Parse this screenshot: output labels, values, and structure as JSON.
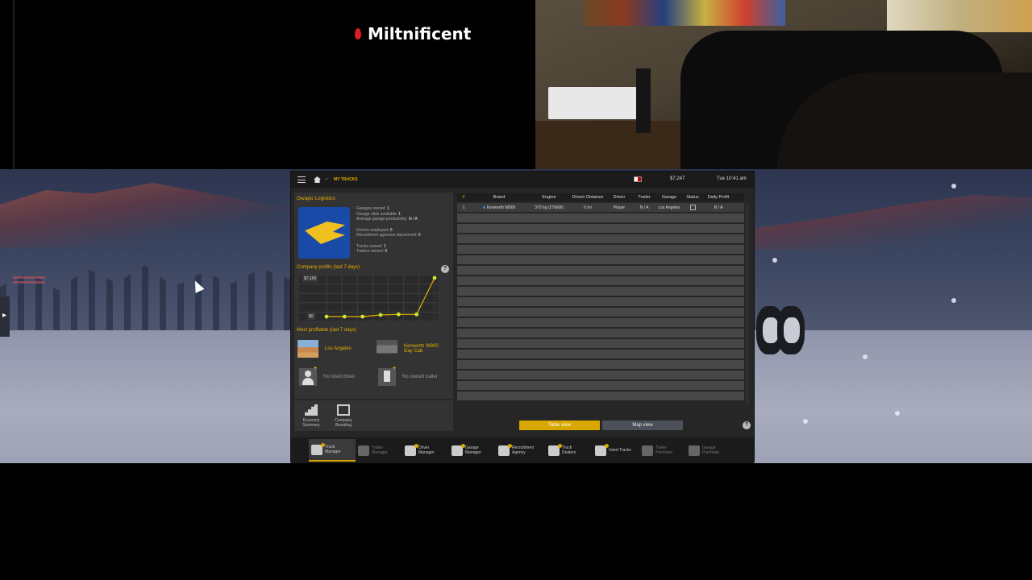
{
  "stream": {
    "name": "Miltnificent"
  },
  "topbar": {
    "breadcrumb": "MY TRUCKS",
    "money": "$7,247",
    "clock": "Tue 10:41 am"
  },
  "company": {
    "name": "Gwapo Logistics",
    "stats": {
      "garages_owned": "Garages owned: ",
      "garages_owned_v": "1",
      "garage_slots": "Garage slots available: ",
      "garage_slots_v": "1",
      "productivity": "Average garage productivity: ",
      "productivity_v": "N / A",
      "drivers": "Drivers employed: ",
      "drivers_v": "0",
      "agencies": "Recruitment agencies discovered: ",
      "agencies_v": "0",
      "trucks": "Trucks owned: ",
      "trucks_v": "1",
      "trailers": "Trailers owned: ",
      "trailers_v": "0"
    }
  },
  "profits": {
    "title": "Company profits (last 7 days)",
    "y_top": "$7,100",
    "y_bottom": "$0"
  },
  "chart_data": {
    "type": "line",
    "title": "Company profits (last 7 days)",
    "x": [
      1,
      2,
      3,
      4,
      5,
      6,
      7
    ],
    "values": [
      0,
      0,
      0,
      300,
      400,
      400,
      7100
    ],
    "ylim": [
      0,
      7100
    ],
    "color": "#e8b000"
  },
  "most_profitable": {
    "title": "Most profitable (last 7 days)",
    "city": "Los Angeles",
    "truck": "Kenworth W900 Day Cab",
    "driver": "No hired driver",
    "trailer": "No owned trailer"
  },
  "tools": [
    {
      "label": "Economy Summary"
    },
    {
      "label": "Company Branding"
    }
  ],
  "table": {
    "headers": [
      "#",
      "Brand",
      "Engine",
      "Driven Distance",
      "Driver",
      "Trailer",
      "Garage",
      "Status",
      "Daily Profit"
    ],
    "rows": [
      {
        "idx": "1",
        "brand": "Kenworth W900",
        "engine": "370 hp (276kW)",
        "distance": "0 mi",
        "driver": "Player",
        "trailer": "N / A",
        "garage": "Los Angeles",
        "profit": "N / A"
      }
    ]
  },
  "views": {
    "table": "Table view",
    "map": "Map view"
  },
  "nav": [
    {
      "l1": "Truck",
      "l2": "Manager",
      "active": true
    },
    {
      "l1": "Trailer",
      "l2": "Manager",
      "dim": true
    },
    {
      "l1": "Driver",
      "l2": "Manager"
    },
    {
      "l1": "Garage",
      "l2": "Manager"
    },
    {
      "l1": "Recruitment",
      "l2": "Agency"
    },
    {
      "l1": "Truck",
      "l2": "Dealers"
    },
    {
      "l1": "Used Trucks",
      "l2": ""
    },
    {
      "l1": "Trailer",
      "l2": "Purchase",
      "dim": true
    },
    {
      "l1": "Garage",
      "l2": "Purchase",
      "dim": true
    }
  ],
  "help": "?"
}
